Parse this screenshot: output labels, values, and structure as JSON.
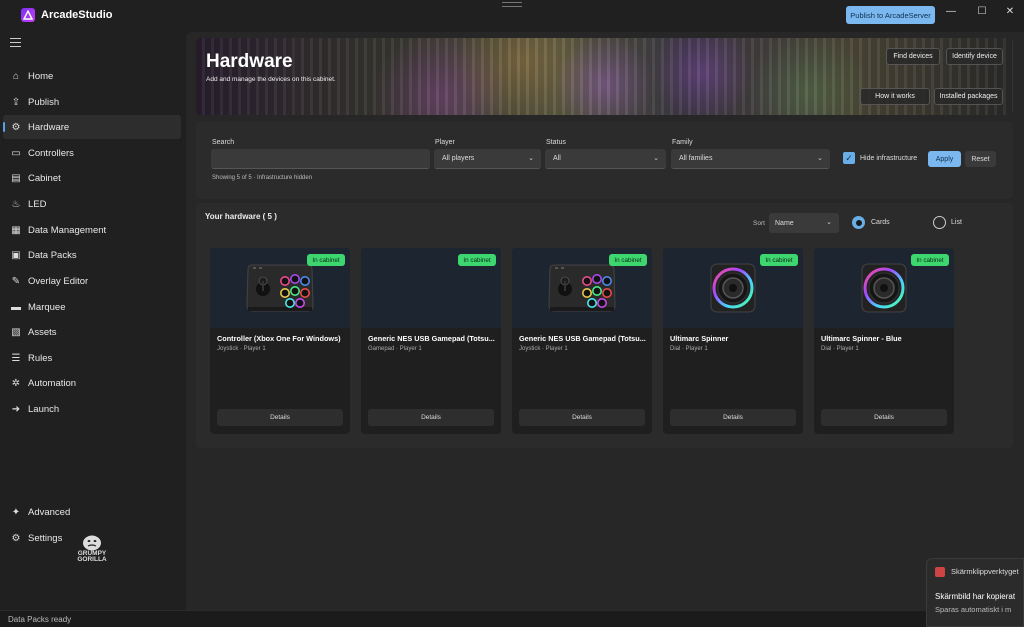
{
  "window": {
    "title": "ArcadeStudio",
    "publish_button": "Publish to ArcadeServer",
    "minimize": "—",
    "maximize": "☐",
    "close": "✕"
  },
  "sidebar": {
    "items": [
      {
        "label": "Home",
        "icon": "home-icon"
      },
      {
        "label": "Publish",
        "icon": "publish-icon"
      },
      {
        "label": "Hardware",
        "icon": "hardware-icon",
        "active": true
      },
      {
        "label": "Controllers",
        "icon": "controllers-icon"
      },
      {
        "label": "Cabinet",
        "icon": "cabinet-icon"
      },
      {
        "label": "LED",
        "icon": "led-icon"
      },
      {
        "label": "Data Management",
        "icon": "data-management-icon"
      },
      {
        "label": "Data Packs",
        "icon": "data-packs-icon"
      },
      {
        "label": "Overlay Editor",
        "icon": "overlay-editor-icon"
      },
      {
        "label": "Marquee",
        "icon": "marquee-icon"
      },
      {
        "label": "Assets",
        "icon": "assets-icon"
      },
      {
        "label": "Rules",
        "icon": "rules-icon"
      },
      {
        "label": "Automation",
        "icon": "automation-icon"
      },
      {
        "label": "Launch",
        "icon": "launch-icon"
      }
    ],
    "bottom_items": [
      {
        "label": "Advanced",
        "icon": "advanced-icon"
      },
      {
        "label": "Settings",
        "icon": "settings-icon"
      }
    ],
    "logo_line1": "GRUMPY",
    "logo_line2": "GORILLA"
  },
  "hero": {
    "title": "Hardware",
    "subtitle": "Add and manage the devices on this cabinet.",
    "find_devices": "Find devices",
    "identify_device": "Identify device",
    "how_it_works": "How it works",
    "installed_packages": "Installed packages"
  },
  "filters": {
    "search_label": "Search",
    "search_value": "",
    "player_label": "Player",
    "player_value": "All players",
    "status_label": "Status",
    "status_value": "All",
    "family_label": "Family",
    "family_value": "All families",
    "hide_infrastructure": "Hide infrastructure",
    "hide_infrastructure_checked": true,
    "apply": "Apply",
    "reset": "Reset",
    "showing": "Showing 5 of 5 · Infrastructure hidden"
  },
  "hardware": {
    "title": "Your hardware ( 5 )",
    "sort_label": "Sort",
    "sort_value": "Name",
    "view_cards": "Cards",
    "view_list": "List",
    "view_selected": "Cards",
    "cards": [
      {
        "name": "Controller (Xbox One For Windows)",
        "meta": "Joystick · Player 1",
        "badge": "In cabinet",
        "image": "arcade-stick",
        "button": "Details"
      },
      {
        "name": "Generic NES USB Gamepad (Totsu...",
        "meta": "Gamepad · Player 1",
        "badge": "In cabinet",
        "image": "none",
        "button": "Details"
      },
      {
        "name": "Generic NES USB Gamepad (Totsu...",
        "meta": "Joystick · Player 1",
        "badge": "In cabinet",
        "image": "arcade-stick",
        "button": "Details"
      },
      {
        "name": "Ultimarc Spinner",
        "meta": "Dial · Player 1",
        "badge": "In cabinet",
        "image": "spinner",
        "button": "Details"
      },
      {
        "name": "Ultimarc Spinner - Blue",
        "meta": "Dial · Player 1",
        "badge": "In cabinet",
        "image": "spinner",
        "button": "Details"
      }
    ]
  },
  "status_bar": {
    "text": "Data Packs ready"
  },
  "toast": {
    "app": "Skärmklippverktyget",
    "title": "Skärmbild har kopierat",
    "text": "Sparas automatiskt i m"
  },
  "colors": {
    "accent": "#7bb8f0",
    "badge": "#3ed66e",
    "background": "#202020",
    "panel": "#2b2b2b"
  }
}
